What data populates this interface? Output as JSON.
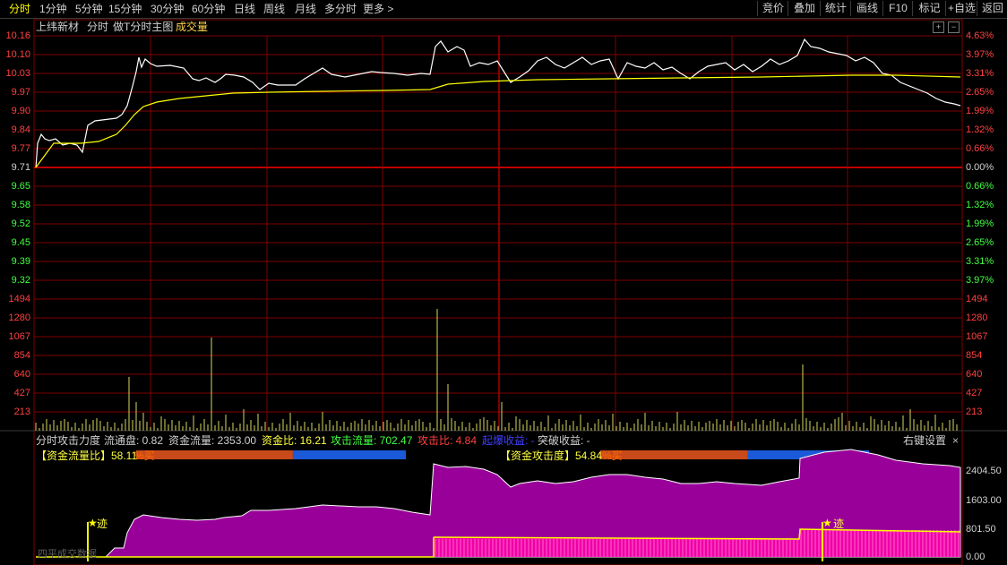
{
  "toolbar": {
    "tabs": [
      "分时",
      "1分钟",
      "5分钟",
      "15分钟",
      "30分钟",
      "60分钟",
      "日线",
      "周线",
      "月线",
      "多分时",
      "更多 >"
    ],
    "active_tab": "分时",
    "buttons": [
      "竞价",
      "叠加",
      "统计",
      "画线",
      "F10",
      "标记",
      "+自选",
      "返回"
    ]
  },
  "header": {
    "stock_name": "上纬新材",
    "mode": "分时",
    "indicator": "做T分时主图",
    "volume_label": "成交量"
  },
  "price_axis": {
    "left": [
      "10.16",
      "10.10",
      "10.03",
      "9.97",
      "9.90",
      "9.84",
      "9.77",
      "9.71",
      "9.65",
      "9.58",
      "9.52",
      "9.45",
      "9.39",
      "9.32"
    ],
    "right": [
      "4.63%",
      "3.97%",
      "3.31%",
      "2.65%",
      "1.99%",
      "1.32%",
      "0.66%",
      "0.00%",
      "0.66%",
      "1.32%",
      "1.99%",
      "2.65%",
      "3.31%",
      "3.97%"
    ]
  },
  "volume_axis": {
    "labels": [
      "1494",
      "1280",
      "1067",
      "854",
      "640",
      "427",
      "213"
    ]
  },
  "indicator_panel": {
    "title": "分时攻击力度",
    "items": [
      {
        "label": "流通盘: 0.82",
        "color": "#d0d0d0"
      },
      {
        "label": "资金流量: 2353.00",
        "color": "#d0d0d0"
      },
      {
        "label": "资金比: 16.21",
        "color": "#ffff40"
      },
      {
        "label": "攻击流量: 702.47",
        "color": "#40ff40"
      },
      {
        "label": "攻击比: 4.84",
        "color": "#ff4040"
      },
      {
        "label": "起爆收益: -",
        "color": "#4040ff"
      },
      {
        "label": "突破收益: -",
        "color": "#d0d0d0"
      }
    ],
    "settings": "右键设置",
    "flow_ratio_label": "【资金流量比】58.11",
    "flow_ratio_suffix": "%买",
    "flow_ratio_value": 0.5811,
    "attack_label": "【资金攻击度】54.84",
    "attack_suffix": "%买",
    "attack_value": 0.5484,
    "right_axis": [
      "2404.50",
      "1603.00",
      "801.50",
      "0.00"
    ],
    "marker_text": "迹",
    "bottom_text": "四平成交数据"
  },
  "colors": {
    "up": "#ff4040",
    "down": "#40ff40",
    "price_line": "#ffffff",
    "avg_line": "#ffff00",
    "volume": "#d8d860",
    "flow_fill": "#990099",
    "attack_fill": "#ff00aa",
    "grid": "#800000"
  }
}
